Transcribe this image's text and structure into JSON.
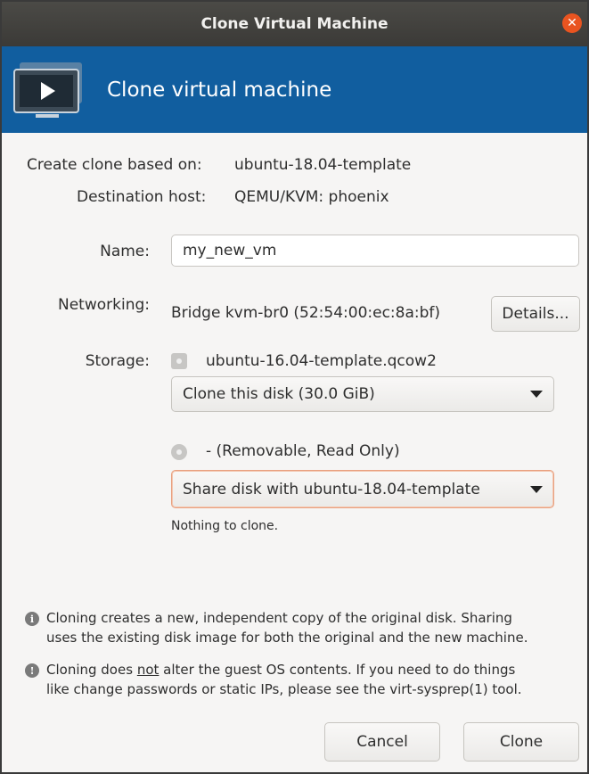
{
  "window": {
    "title": "Clone Virtual Machine",
    "close_glyph": "✕"
  },
  "banner": {
    "title": "Clone virtual machine",
    "icon": "vm-monitor-icon"
  },
  "info": {
    "clone_based_label": "Create clone based on:",
    "clone_based_value": "ubuntu-18.04-template",
    "dest_host_label": "Destination host:",
    "dest_host_value": "QEMU/KVM: phoenix"
  },
  "form": {
    "name_label": "Name:",
    "name_value": "my_new_vm",
    "networking_label": "Networking:",
    "networking_value": "Bridge kvm-br0 (52:54:00:ec:8a:bf)",
    "details_button": "Details...",
    "storage_label": "Storage:",
    "disk1_name": "ubuntu-16.04-template.qcow2",
    "disk1_action": "Clone this disk (30.0 GiB)",
    "disk2_name": "- (Removable, Read Only)",
    "disk2_action": "Share disk with ubuntu-18.04-template",
    "disk2_note": "Nothing to clone."
  },
  "notes": {
    "note1_line1": "Cloning creates a new, independent copy of the original disk. Sharing",
    "note1_line2": "uses the existing disk image for both the original and the new machine.",
    "note2_pre": "Cloning does ",
    "note2_underlined": "not",
    "note2_post": " alter the guest OS contents. If you need to do things",
    "note2_line2": "like change passwords or static IPs, please see the virt-sysprep(1) tool."
  },
  "buttons": {
    "cancel": "Cancel",
    "clone": "Clone"
  },
  "colors": {
    "banner": "#115e9f",
    "titlebar": "#3b3a37",
    "close": "#e95420",
    "focus_border": "#e9a07f"
  }
}
